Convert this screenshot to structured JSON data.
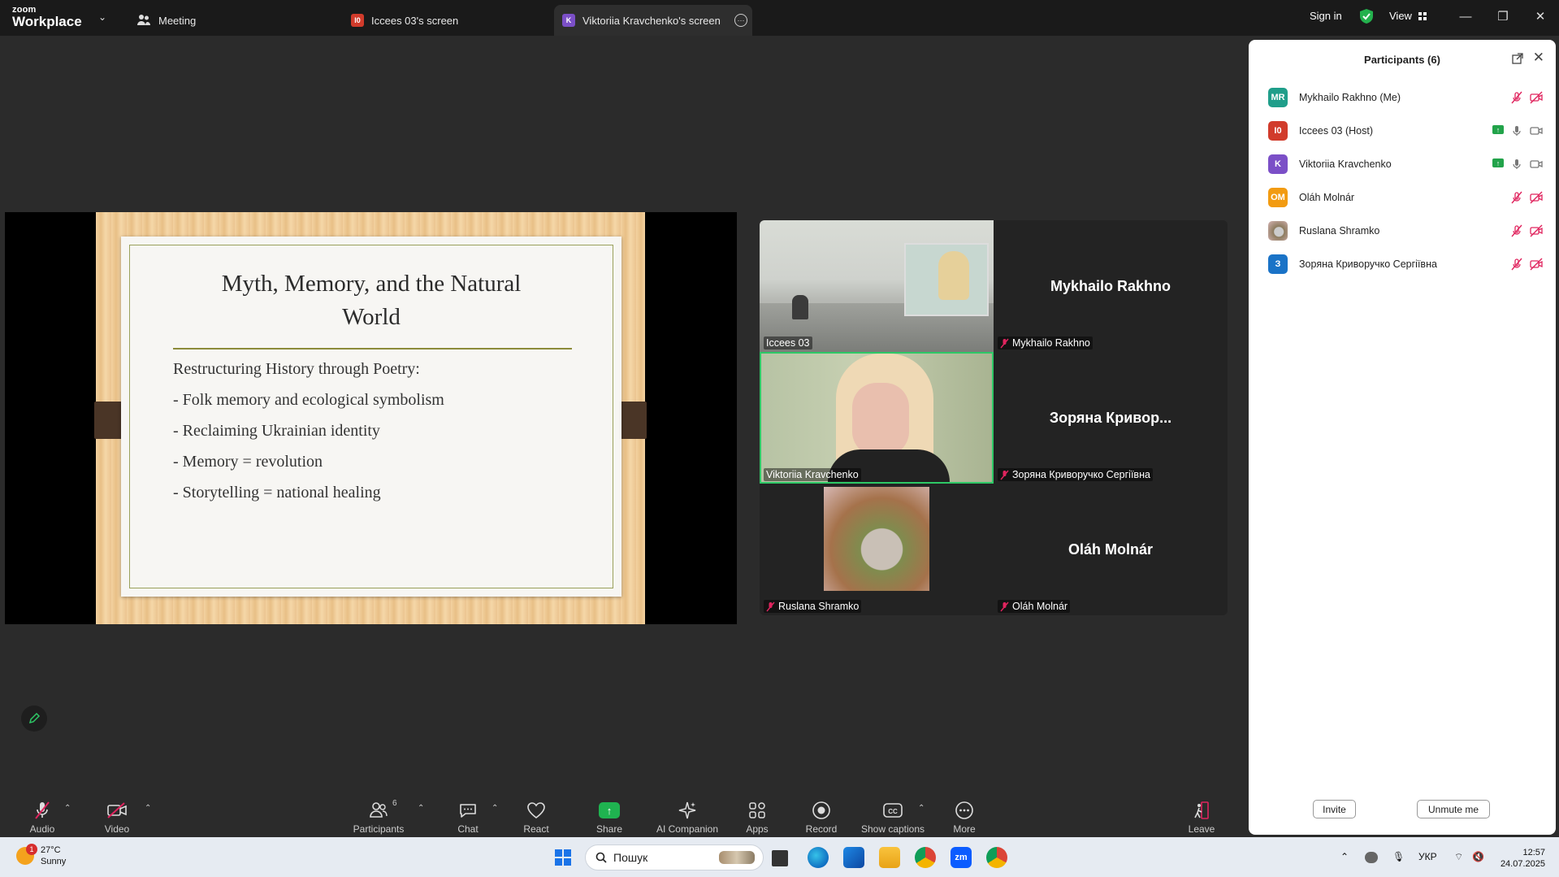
{
  "app": {
    "logo_line1": "zoom",
    "logo_line2": "Workplace",
    "caret": "⌄"
  },
  "tabs": [
    {
      "label": "Meeting",
      "icon": "people-icon"
    },
    {
      "label": "Iccees 03's screen",
      "badge": "I0",
      "badge_color": "#d13b2b"
    },
    {
      "label": "Viktoriia Kravchenko's screen",
      "badge": "K",
      "badge_color": "#7b4fc7",
      "more": "⋯"
    }
  ],
  "header": {
    "signin": "Sign in",
    "view": "View"
  },
  "window_controls": {
    "minimize": "—",
    "restore": "❐",
    "close": "✕"
  },
  "slide": {
    "title_line1": "Myth, Memory, and the Natural",
    "title_line2": "World",
    "lines": [
      "Restructuring History through Poetry:",
      "- Folk memory and ecological symbolism",
      "- Reclaiming Ukrainian identity",
      "- Memory = revolution",
      "- Storytelling = national healing"
    ]
  },
  "video_tiles": [
    {
      "label": "Iccees 03",
      "type": "video-room",
      "muted": false
    },
    {
      "label": "Mykhailo Rakhno",
      "name_big": "Mykhailo Rakhno",
      "type": "name",
      "muted": true
    },
    {
      "label": "Viktoriia Kravchenko",
      "type": "video-person",
      "muted": false,
      "active_speaker": true
    },
    {
      "label": "Зоряна Криворучко Сергіївна",
      "name_big": "Зоряна  Кривор...",
      "type": "name",
      "muted": true
    },
    {
      "label": "Ruslana Shramko",
      "type": "avatar-image",
      "muted": true
    },
    {
      "label": "Oláh Molnár",
      "name_big": "Oláh Molnár",
      "type": "name",
      "muted": true
    }
  ],
  "participants_panel": {
    "title": "Participants (6)",
    "close": "✕",
    "participants": [
      {
        "initials": "MR",
        "color": "#1f9e8a",
        "name": "Mykhailo Rakhno (Me)",
        "mic": "muted",
        "video": "off",
        "sharing": false
      },
      {
        "initials": "I0",
        "color": "#d13b2b",
        "name": "Iccees 03 (Host)",
        "mic": "on",
        "video": "on",
        "sharing": true
      },
      {
        "initials": "K",
        "color": "#7b4fc7",
        "name": "Viktoriia Kravchenko",
        "mic": "on",
        "video": "on",
        "sharing": true
      },
      {
        "initials": "OM",
        "color": "#f29b11",
        "name": "Oláh Molnár",
        "mic": "muted",
        "video": "off",
        "sharing": false
      },
      {
        "initials": "",
        "color": "#b8a89a",
        "name": "Ruslana Shramko",
        "mic": "muted",
        "video": "off",
        "sharing": false,
        "photo": true
      },
      {
        "initials": "З",
        "color": "#1a73c7",
        "name": "Зоряна Криворучко Сергіївна",
        "mic": "muted",
        "video": "off",
        "sharing": false
      }
    ],
    "invite": "Invite",
    "unmute": "Unmute me"
  },
  "toolbar": {
    "audio": "Audio",
    "video": "Video",
    "participants": "Participants",
    "participants_count": "6",
    "chat": "Chat",
    "react": "React",
    "share": "Share",
    "ai_companion": "AI Companion",
    "apps": "Apps",
    "record": "Record",
    "captions": "Show captions",
    "more": "More",
    "leave": "Leave",
    "caret": "⌃"
  },
  "taskbar": {
    "weather_badge": "1",
    "temp": "27°C",
    "condition": "Sunny",
    "search_placeholder": "Пошук",
    "lang": "УКР",
    "time": "12:57",
    "date": "24.07.2025"
  },
  "colors": {
    "accent_green": "#2ec866",
    "mute_red": "#e0245e",
    "topbar": "#1a1a1a",
    "background": "#2b2b2b"
  }
}
